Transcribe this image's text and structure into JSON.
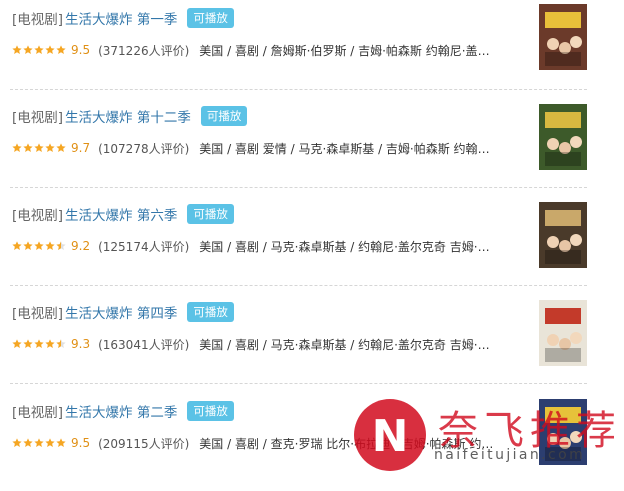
{
  "play_label": "可播放",
  "items": [
    {
      "category": "[电视剧]",
      "title": "生活大爆炸 第一季",
      "stars": 5,
      "score": "9.5",
      "votes": "(371226人评价)",
      "meta": "美国 / 喜剧 / 詹姆斯·伯罗斯 / 吉姆·帕森斯 约翰尼·盖尔…",
      "poster_color": "#6b3a2a",
      "poster_accent": "#e8c03a"
    },
    {
      "category": "[电视剧]",
      "title": "生活大爆炸 第十二季",
      "stars": 5,
      "score": "9.7",
      "votes": "(107278人评价)",
      "meta": "美国 / 喜剧 爱情 / 马克·森卓斯基 / 吉姆·帕森斯 约翰尼·…",
      "poster_color": "#3d5a2a",
      "poster_accent": "#d8b840"
    },
    {
      "category": "[电视剧]",
      "title": "生活大爆炸 第六季",
      "stars": 4.5,
      "score": "9.2",
      "votes": "(125174人评价)",
      "meta": "美国 / 喜剧 / 马克·森卓斯基 / 约翰尼·盖尔克奇 吉姆·帕…",
      "poster_color": "#4a3a2a",
      "poster_accent": "#c9a86a"
    },
    {
      "category": "[电视剧]",
      "title": "生活大爆炸 第四季",
      "stars": 4.5,
      "score": "9.3",
      "votes": "(163041人评价)",
      "meta": "美国 / 喜剧 / 马克·森卓斯基 / 约翰尼·盖尔克奇 吉姆·帕…",
      "poster_color": "#e9e4d8",
      "poster_accent": "#c33a2a"
    },
    {
      "category": "[电视剧]",
      "title": "生活大爆炸 第二季",
      "stars": 5,
      "score": "9.5",
      "votes": "(209115人评价)",
      "meta": "美国 / 喜剧 / 查克·罗瑞 比尔·布拉迪 / 吉姆·帕森斯 约翰…",
      "poster_color": "#2c3e70",
      "poster_accent": "#e6c23a"
    }
  ],
  "watermark": {
    "logo": "N",
    "text": "奈飞推荐",
    "url": "naifeitujian.com",
    "color": "#d10a1d"
  }
}
